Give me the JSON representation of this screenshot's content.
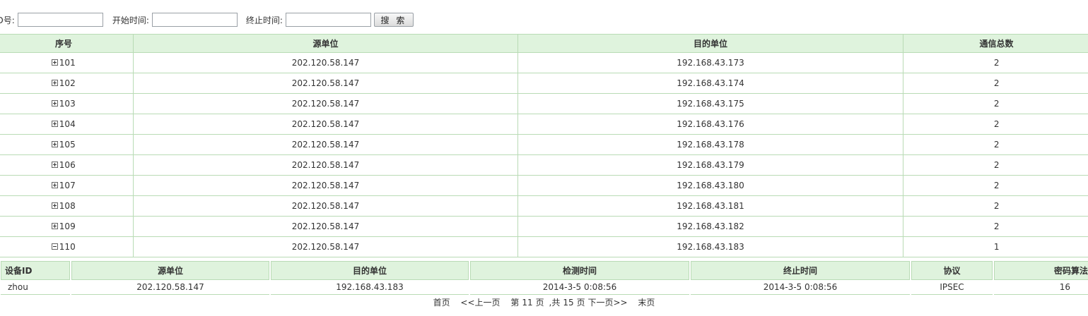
{
  "search": {
    "id_label": "ID号:",
    "start_label": "开始时间:",
    "end_label": "终止时间:",
    "button_label": "搜 索",
    "id_value": "",
    "start_value": "",
    "end_value": ""
  },
  "main_table": {
    "headers": [
      "序号",
      "源单位",
      "目的单位",
      "通信总数"
    ],
    "rows": [
      {
        "seq": "101",
        "src": "202.120.58.147",
        "dst": "192.168.43.173",
        "count": "2",
        "expanded": false
      },
      {
        "seq": "102",
        "src": "202.120.58.147",
        "dst": "192.168.43.174",
        "count": "2",
        "expanded": false
      },
      {
        "seq": "103",
        "src": "202.120.58.147",
        "dst": "192.168.43.175",
        "count": "2",
        "expanded": false
      },
      {
        "seq": "104",
        "src": "202.120.58.147",
        "dst": "192.168.43.176",
        "count": "2",
        "expanded": false
      },
      {
        "seq": "105",
        "src": "202.120.58.147",
        "dst": "192.168.43.178",
        "count": "2",
        "expanded": false
      },
      {
        "seq": "106",
        "src": "202.120.58.147",
        "dst": "192.168.43.179",
        "count": "2",
        "expanded": false
      },
      {
        "seq": "107",
        "src": "202.120.58.147",
        "dst": "192.168.43.180",
        "count": "2",
        "expanded": false
      },
      {
        "seq": "108",
        "src": "202.120.58.147",
        "dst": "192.168.43.181",
        "count": "2",
        "expanded": false
      },
      {
        "seq": "109",
        "src": "202.120.58.147",
        "dst": "192.168.43.182",
        "count": "2",
        "expanded": false
      },
      {
        "seq": "110",
        "src": "202.120.58.147",
        "dst": "192.168.43.183",
        "count": "1",
        "expanded": true
      }
    ]
  },
  "detail_table": {
    "headers": [
      "设备ID",
      "源单位",
      "目的单位",
      "检测时间",
      "终止时间",
      "协议",
      "密码算法"
    ],
    "rows": [
      [
        "zhou",
        "202.120.58.147",
        "192.168.43.183",
        "2014-3-5 0:08:56",
        "2014-3-5 0:08:56",
        "IPSEC",
        "16"
      ]
    ]
  },
  "pager": {
    "first": "首页",
    "prev": "<<上一页",
    "current_prefix": "第",
    "current": "11",
    "current_suffix": "页",
    "total_prefix": ",共",
    "total": "15",
    "total_suffix": "页",
    "next": "下一页>>",
    "last": "末页"
  },
  "colors": {
    "header_bg": "#dff3dd",
    "border": "#b9dbb5"
  },
  "icons": {
    "collapsed": "expand-plus-icon",
    "expanded": "collapse-minus-icon"
  }
}
